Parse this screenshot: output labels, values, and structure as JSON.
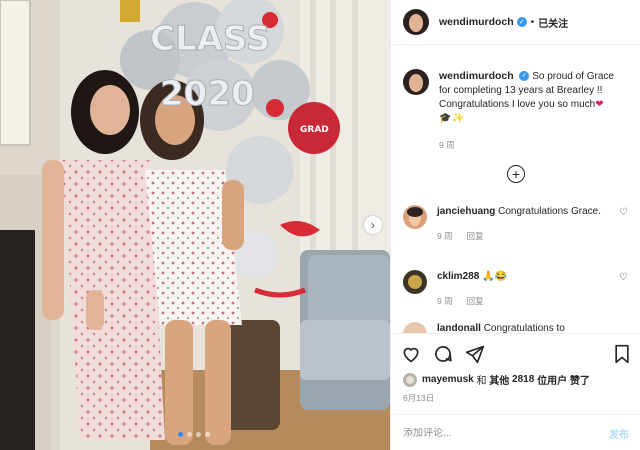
{
  "post": {
    "author": "wendimurdoch",
    "follow_sep": "•",
    "follow_label": "已关注",
    "caption_text": "So proud of Grace for completing 13 years at Brearley !! Congratulations I love you so much",
    "caption_emoji": "❤",
    "caption_emoji2": "🎓✨",
    "caption_time": "9 周",
    "balloon_text_line1": "CLASS",
    "balloon_text_line2": "2020",
    "balloon_badge": "GRAD",
    "carousel_dots": 4,
    "active_dot": 0
  },
  "comments": [
    {
      "user": "janciehuang",
      "text": "Congratulations Grace.",
      "time": "9 周",
      "reply": "回复"
    },
    {
      "user": "cklim288",
      "text": "🙏😂",
      "time": "9 周",
      "reply": "回复"
    },
    {
      "user": "landonall",
      "text": "Congratulations to"
    }
  ],
  "likes": {
    "user": "mayemusk",
    "connector": "和",
    "others_prefix": "其他",
    "count": "2818",
    "suffix": "位用户 赞了"
  },
  "date": "6月13日",
  "add_comment": {
    "placeholder": "添加评论...",
    "post_label": "发布"
  },
  "colors": {
    "accent_blue": "#3897f0",
    "heart_red": "#e0245e",
    "muted": "#8e8e8e"
  }
}
